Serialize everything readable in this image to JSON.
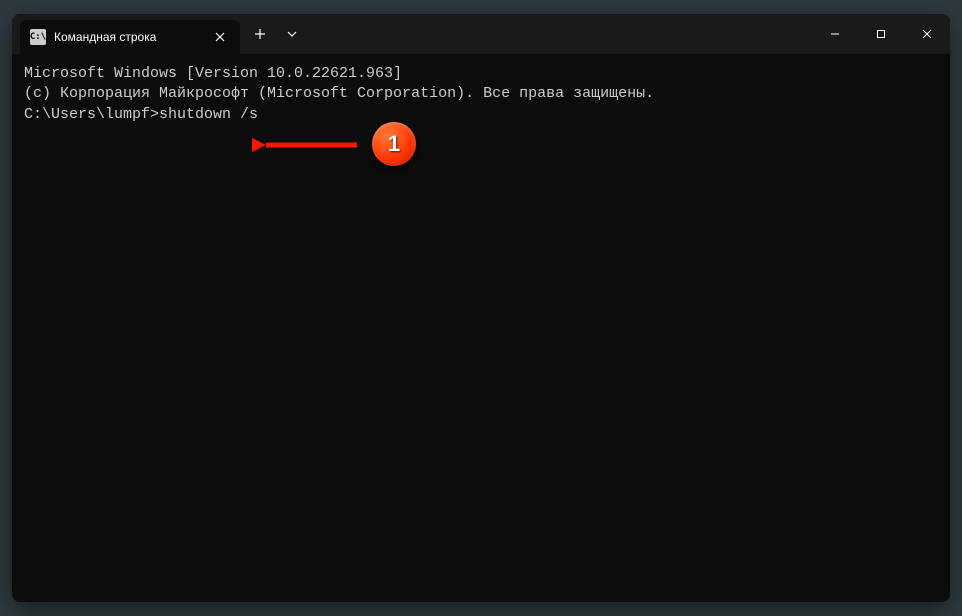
{
  "tab": {
    "title": "Командная строка",
    "icon_label": "C:\\"
  },
  "terminal": {
    "line1": "Microsoft Windows [Version 10.0.22621.963]",
    "line2": "(c) Корпорация Майкрософт (Microsoft Corporation). Все права защищены.",
    "blank": "",
    "prompt": "C:\\Users\\lumpf>",
    "command": "shutdown /s"
  },
  "annotation": {
    "number": "1"
  }
}
